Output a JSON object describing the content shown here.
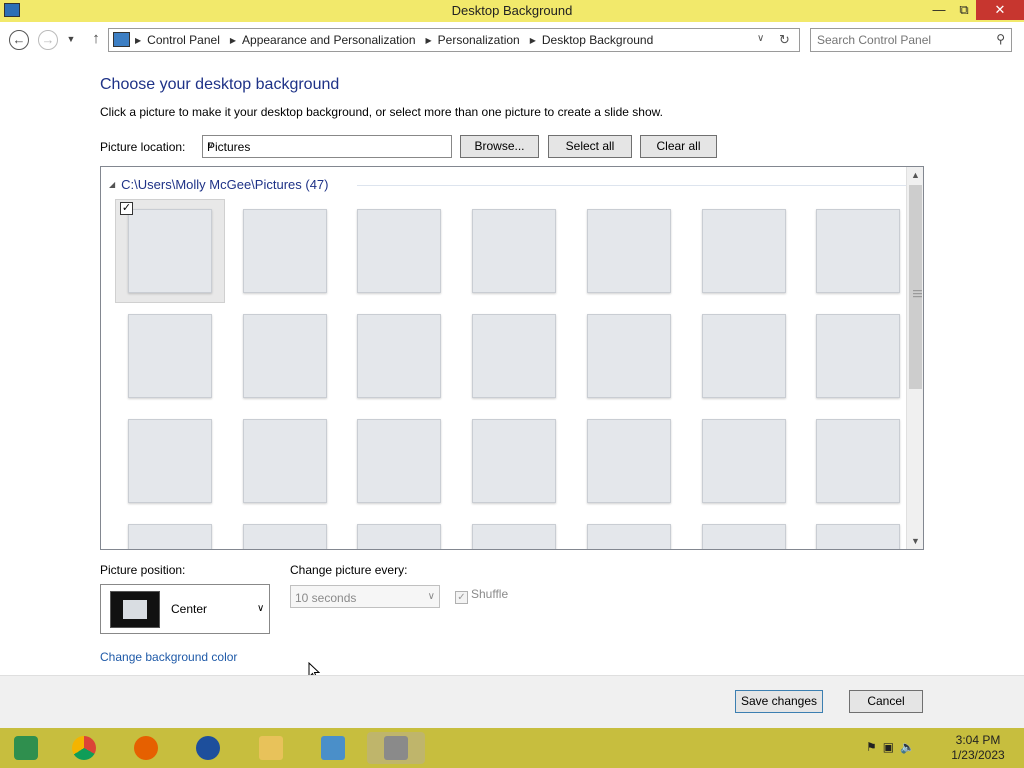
{
  "window": {
    "title": "Desktop Background",
    "minimize": "—",
    "maximize": "⧉",
    "close": "✕"
  },
  "nav": {
    "breadcrumbs": [
      "Control Panel",
      "Appearance and Personalization",
      "Personalization",
      "Desktop Background"
    ],
    "search_placeholder": "Search Control Panel"
  },
  "content": {
    "heading": "Choose your desktop background",
    "subtext": "Click a picture to make it your desktop background, or select more than one picture to create a slide show.",
    "picture_location_label": "Picture location:",
    "picture_location_value": "Pictures",
    "browse_label": "Browse...",
    "select_all_label": "Select all",
    "clear_all_label": "Clear all"
  },
  "gallery": {
    "group_header": "C:\\Users\\Molly McGee\\Pictures (47)",
    "thumbnail_count": 28,
    "selected_index": 0
  },
  "options": {
    "position_label": "Picture position:",
    "position_value": "Center",
    "interval_label": "Change picture every:",
    "interval_value": "10 seconds",
    "shuffle_label": "Shuffle",
    "shuffle_checked": true,
    "change_color_link": "Change background color"
  },
  "footer": {
    "save_label": "Save changes",
    "cancel_label": "Cancel"
  },
  "taskbar": {
    "time": "3:04 PM",
    "date": "1/23/2023"
  },
  "colors": {
    "titlebar": "#f2e96b",
    "heading": "#1e3287",
    "link": "#1f5aa8",
    "taskbar": "#c7be3e"
  }
}
